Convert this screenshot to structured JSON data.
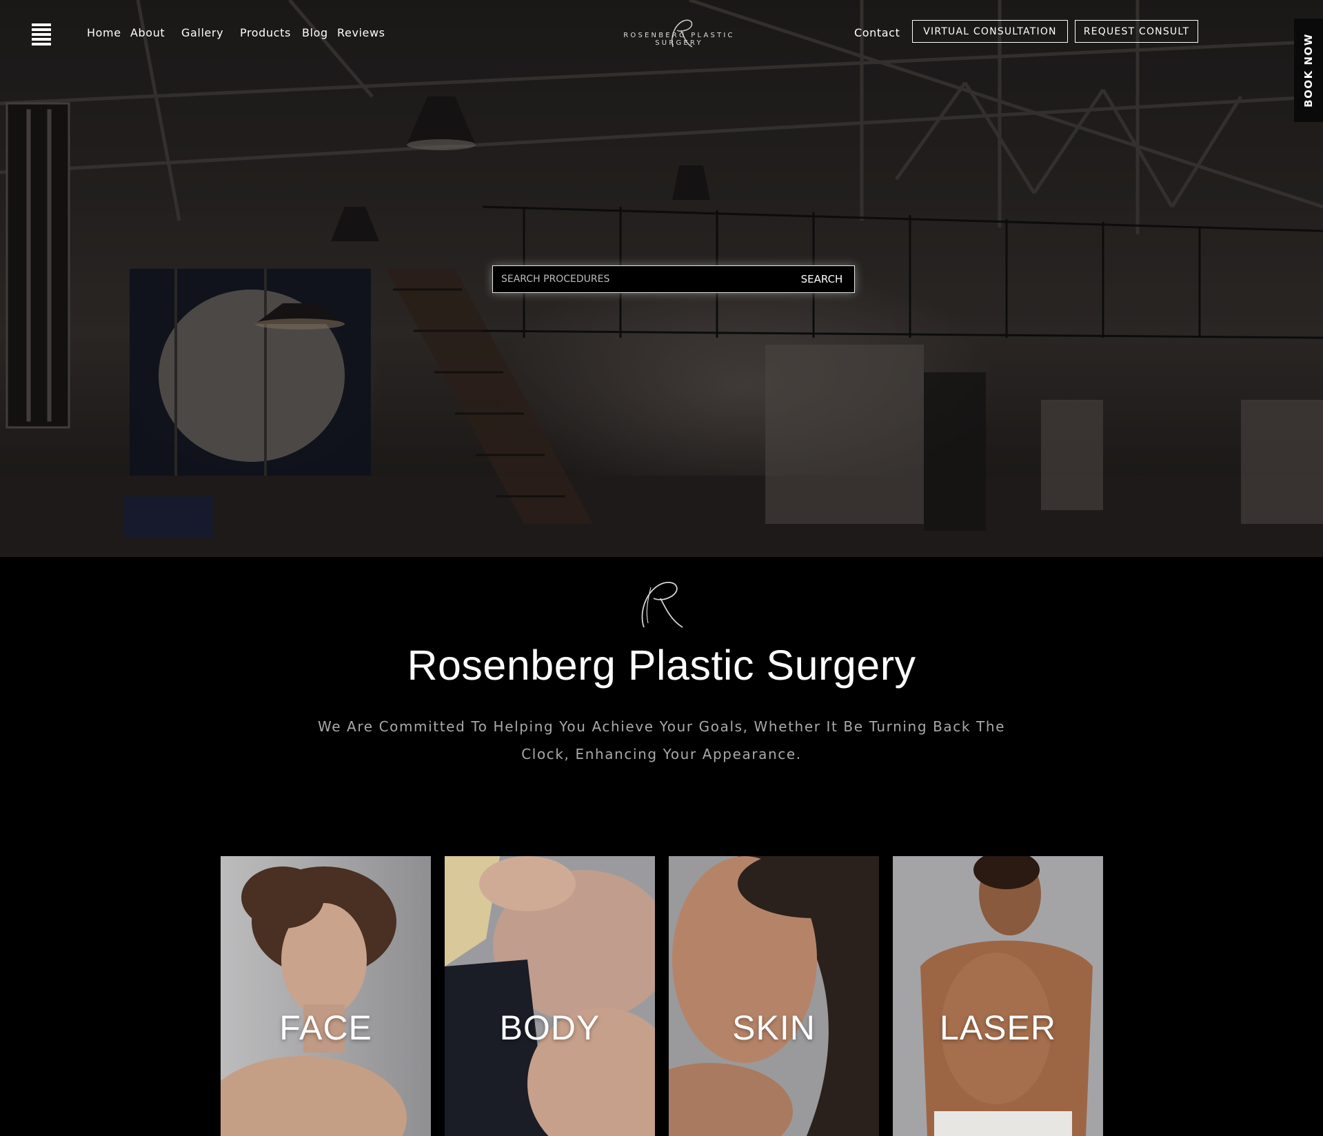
{
  "header": {
    "nav_left": [
      "Home",
      "About",
      "Gallery",
      "Products",
      "Blog",
      "Reviews"
    ],
    "logo_text": "ROSENBERG PLASTIC SURGERY",
    "contact_label": "Contact",
    "virtual_consultation_label": "VIRTUAL CONSULTATION",
    "request_consult_label": "REQUEST CONSULT",
    "book_now_label": "BOOK NOW"
  },
  "search": {
    "placeholder": "SEARCH PROCEDURES",
    "value": "",
    "button_label": "SEARCH"
  },
  "intro": {
    "title": "Rosenberg Plastic Surgery",
    "tagline": "We Are Committed To Helping You Achieve Your Goals, Whether It Be Turning Back The Clock, Enhancing Your Appearance."
  },
  "categories": [
    "FACE",
    "BODY",
    "SKIN",
    "LASER"
  ],
  "icons": {
    "menu": "hamburger-menu-icon",
    "monogram": "script-r-monogram"
  },
  "colors": {
    "background": "#000000",
    "text": "#ffffff",
    "tagline": "#a9a9a9"
  }
}
